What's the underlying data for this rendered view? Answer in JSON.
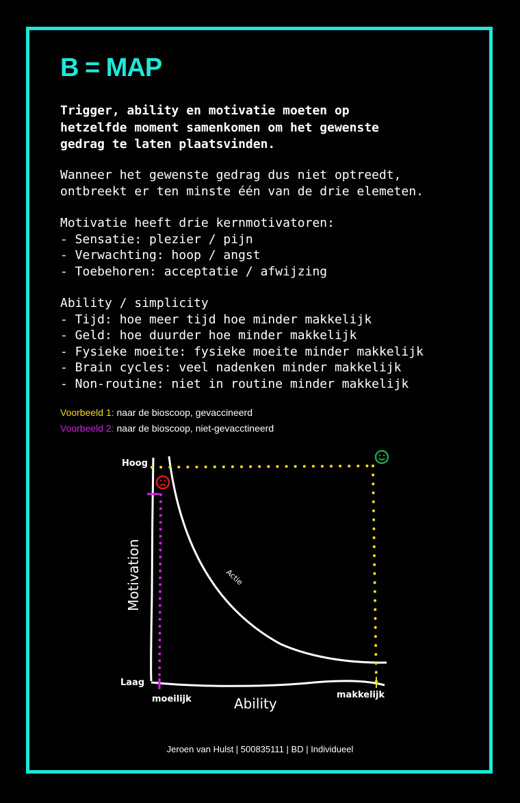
{
  "title": "B = MAP",
  "lead": "Trigger, ability en motivatie moeten op\nhetzelfde moment samenkomen om het gewenste\ngedrag te laten plaatsvinden.",
  "paragraphs": {
    "p1": "Wanneer het gewenste gedrag dus niet optreedt,\nontbreekt er ten minste één van de drie elemeten.",
    "p2": "Motivatie heeft drie kernmotivatoren:\n- Sensatie: plezier / pijn\n- Verwachting: hoop / angst\n- Toebehoren: acceptatie / afwijzing",
    "p3": "Ability / simplicity\n- Tijd: hoe meer tijd hoe minder makkelijk\n- Geld: hoe duurder hoe minder makkelijk\n- Fysieke moeite: fysieke moeite minder makkelijk\n- Brain cycles: veel nadenken minder makkelijk\n- Non-routine: niet in routine minder makkelijk"
  },
  "examples": [
    {
      "label": "Voorbeeld 1:",
      "text": " naar de bioscoop, gevaccineerd",
      "color": "#f2dc1a"
    },
    {
      "label": "Voorbeeld 2:",
      "text": " naar de bioscoop, niet-gevacctineerd",
      "color": "#d21ee6"
    }
  ],
  "diagram": {
    "y_axis_label": "Motivation",
    "x_axis_label": "Ability",
    "y_high": "Hoog",
    "y_low": "Laag",
    "x_low": "moeilijk",
    "x_high": "makkelijk",
    "curve_label": "Actie",
    "happy_icon": "smiley-face-icon",
    "sad_icon": "sad-face-icon",
    "colors": {
      "happy": "#1fa34a",
      "sad": "#e01b1b",
      "yellow": "#f2dc1a",
      "magenta": "#d21ee6",
      "accent": "#1ee8d9"
    }
  },
  "footer": "Jeroen van Hulst | 500835111 | BD | Individueel"
}
